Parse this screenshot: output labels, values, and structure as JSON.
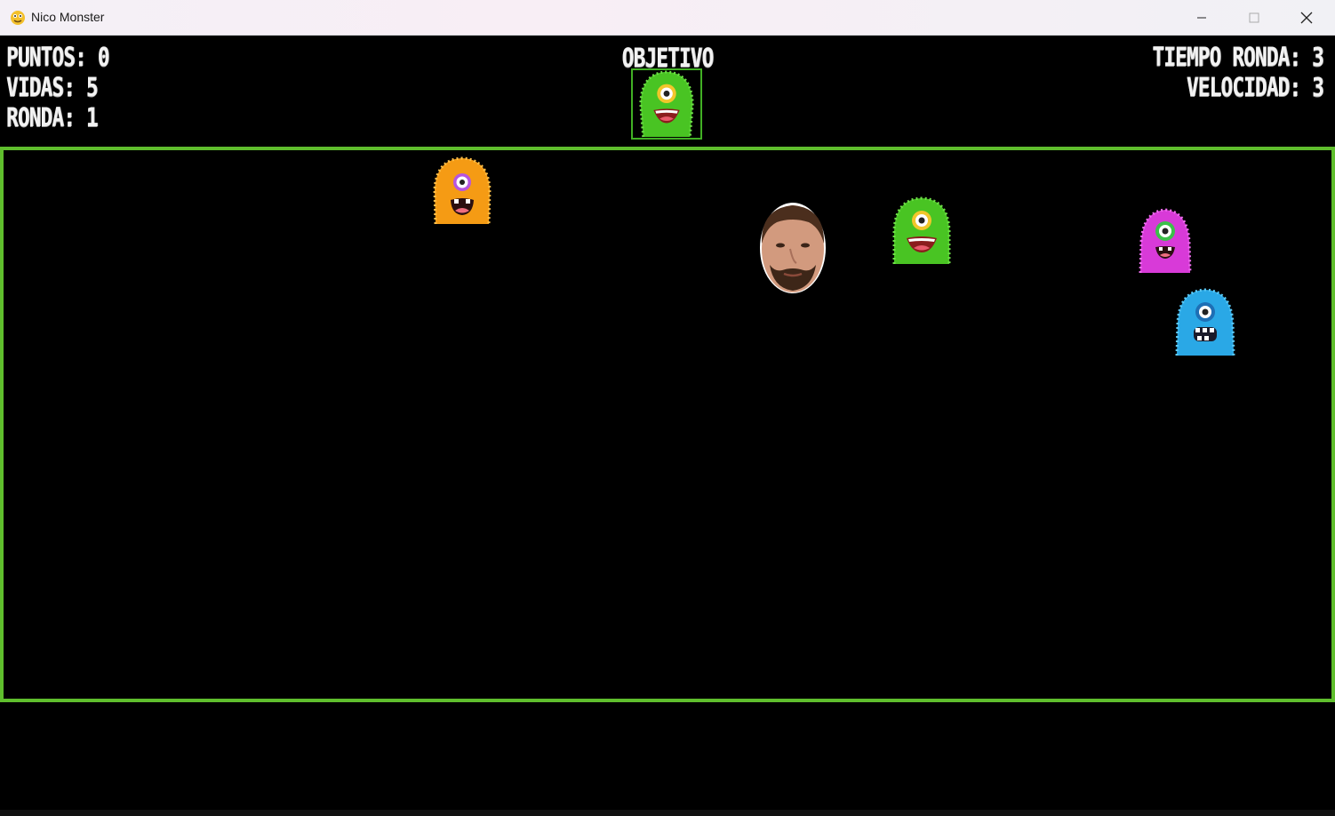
{
  "window": {
    "title": "Nico Monster",
    "icon": "pygame-snake-icon",
    "controls": [
      "minimize-icon",
      "maximize-icon",
      "close-icon"
    ]
  },
  "hud": {
    "puntos": "PUNTOS: 0",
    "vidas": "VIDAS: 5",
    "ronda": "RONDA: 1",
    "objetivo": "OBJETIVO",
    "tiempo_ronda": "TIEMPO RONDA: 3",
    "velocidad": "VELOCIDAD: 3"
  },
  "target_monster": {
    "color": "green",
    "hex": "#49c423"
  },
  "monsters": [
    {
      "color": "orange",
      "hex": "#f59b14"
    },
    {
      "color": "green",
      "hex": "#49c423"
    },
    {
      "color": "pink",
      "hex": "#d83ad8"
    },
    {
      "color": "blue",
      "hex": "#2aa8e6"
    }
  ],
  "player": {
    "name": "nico-face"
  },
  "colors": {
    "field_border": "#5fbe2d",
    "background": "#000000",
    "hud_text": "#f2f2f2"
  }
}
